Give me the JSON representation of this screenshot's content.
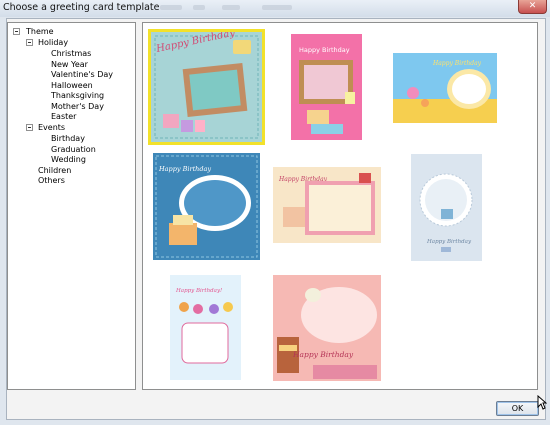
{
  "window": {
    "title": "Choose a greeting card template",
    "close_glyph": "✕"
  },
  "tree": {
    "theme": "Theme",
    "holiday": "Holiday",
    "holiday_items": [
      "Christmas",
      "New Year",
      "Valentine's Day",
      "Halloween",
      "Thanksgiving",
      "Mother's Day",
      "Easter"
    ],
    "events": "Events",
    "events_items": [
      "Birthday",
      "Graduation",
      "Wedding"
    ],
    "children": "Children",
    "others": "Others"
  },
  "templates": [
    {
      "text": "Happy Birthday",
      "selected": true
    },
    {
      "text": "Happy Birthday"
    },
    {
      "text": "Happy Birthday"
    },
    {
      "text": "Happy Birthday"
    },
    {
      "text": "Happy Birthday"
    },
    {
      "text": "Happy Birthday"
    },
    {
      "text": "Happy Birthday!"
    },
    {
      "text": "Happy Birthday"
    }
  ],
  "buttons": {
    "ok": "OK"
  },
  "icons": [
    "close-icon",
    "minus-icon",
    "mouse-cursor-icon"
  ],
  "colors": {
    "selection_outline": "#f2e12a",
    "titlebar": "#dfe6ee",
    "close_button": "#c75050"
  }
}
